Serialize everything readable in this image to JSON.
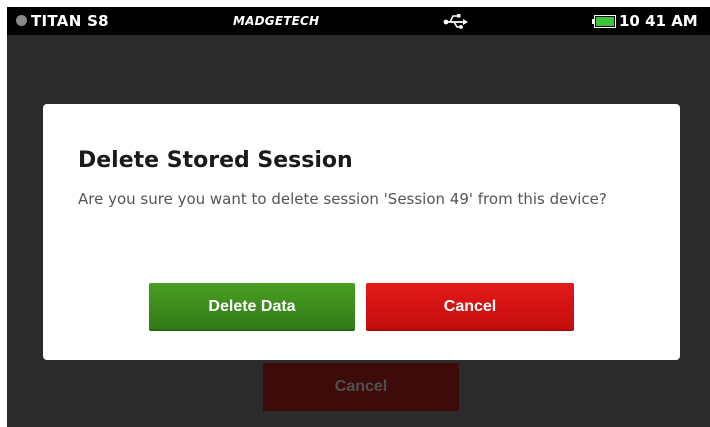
{
  "status_bar": {
    "device_name": "TITAN S8",
    "brand": "MADGETECH",
    "usb_icon": "usb-icon",
    "battery_icon": "battery-icon",
    "battery_color": "#3cc43c",
    "time": "10 41 AM"
  },
  "background_screen": {
    "cancel_label": "Cancel"
  },
  "dialog": {
    "title": "Delete Stored Session",
    "message": "Are you sure you want to delete session 'Session 49' from this device?",
    "delete_label": "Delete Data",
    "cancel_label": "Cancel"
  },
  "colors": {
    "delete_button": "#3c8c1e",
    "cancel_button": "#d71414",
    "status_bar": "#000000",
    "background": "#2b2b2b"
  }
}
